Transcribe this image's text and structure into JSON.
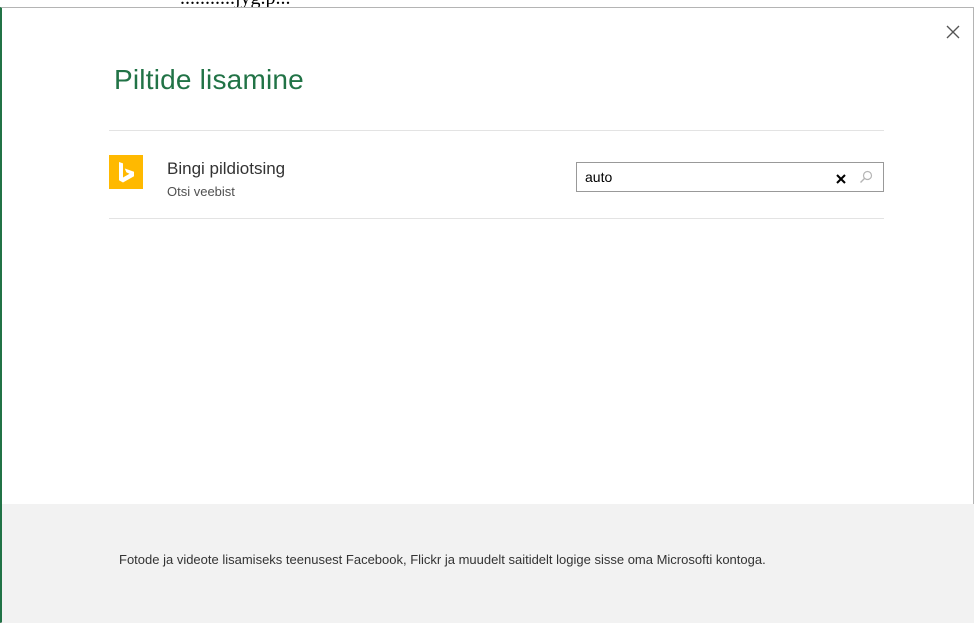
{
  "background_text": "...........jyg.p...",
  "dialog": {
    "title": "Piltide lisamine",
    "close_icon": "close-icon",
    "accent_color": "#217346"
  },
  "source": {
    "logo_icon": "bing-logo-icon",
    "logo_color": "#ffb900",
    "name": "Bingi pildiotsing",
    "subtitle": "Otsi veebist"
  },
  "search": {
    "value": "auto",
    "clear_icon": "clear-icon",
    "search_icon": "search-icon"
  },
  "footer": {
    "text": "Fotode ja videote lisamiseks teenusest Facebook, Flickr ja muudelt saitidelt logige sisse oma Microsofti kontoga."
  }
}
